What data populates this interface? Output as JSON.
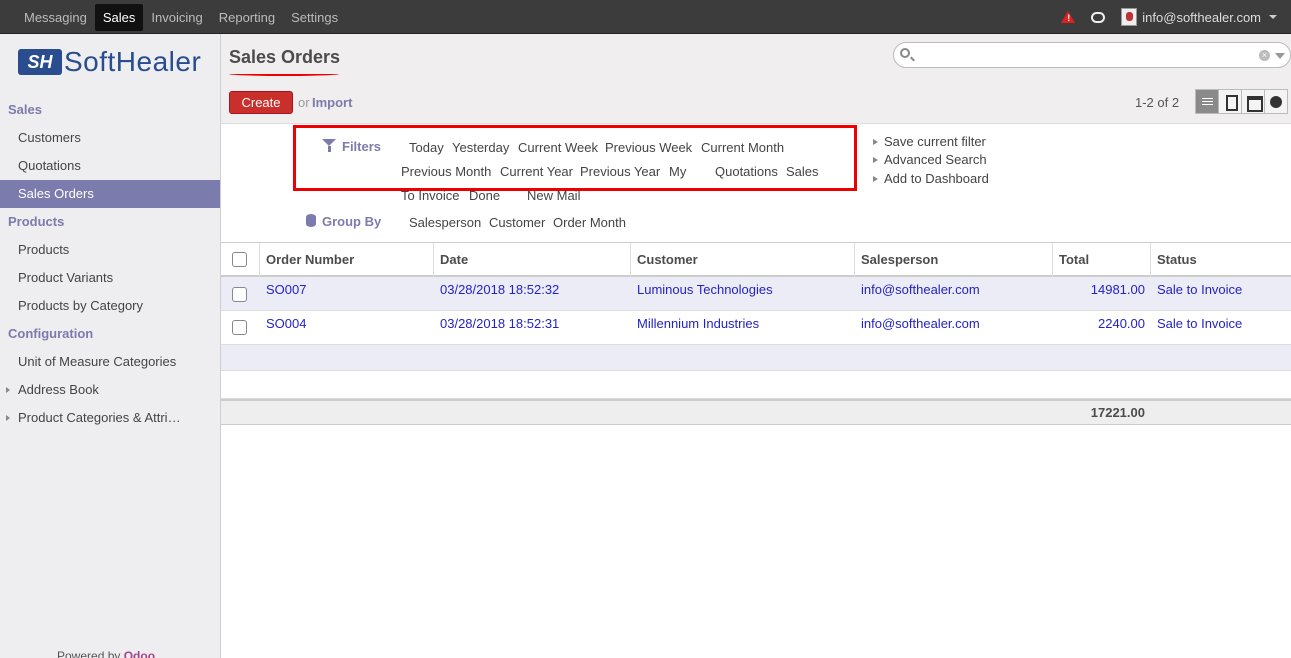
{
  "topnav": {
    "items": [
      "Messaging",
      "Sales",
      "Invoicing",
      "Reporting",
      "Settings"
    ],
    "active": "Sales",
    "user_email": "info@softhealer.com"
  },
  "sidebar": {
    "logo_mark": "SH",
    "logo_text": "SoftHealer",
    "sections": [
      {
        "title": "Sales",
        "items": [
          "Customers",
          "Quotations",
          "Sales Orders"
        ]
      },
      {
        "title": "Products",
        "items": [
          "Products",
          "Product Variants",
          "Products by Category"
        ]
      },
      {
        "title": "Configuration",
        "items": [
          "Unit of Measure Categories",
          "Address Book",
          "Product Categories & Attri…"
        ]
      }
    ],
    "powered_by": "Powered by",
    "powered_brand": "Odoo"
  },
  "header": {
    "title": "Sales Orders",
    "create_label": "Create",
    "or_label": "or",
    "import_label": "Import",
    "pager": "1-2 of 2",
    "search_placeholder": ""
  },
  "filters": {
    "label": "Filters",
    "options": [
      "Today",
      "Yesterday",
      "Current Week",
      "Previous Week",
      "Current Month",
      "Previous Month",
      "Current Year",
      "Previous Year",
      "My",
      "Quotations",
      "Sales",
      "To Invoice",
      "Done",
      "New Mail"
    ],
    "groupby_label": "Group By",
    "groupby_options": [
      "Salesperson",
      "Customer",
      "Order Month"
    ],
    "side_options": [
      "Save current filter",
      "Advanced Search",
      "Add to Dashboard"
    ]
  },
  "table": {
    "columns": [
      "Order Number",
      "Date",
      "Customer",
      "Salesperson",
      "Total",
      "Status"
    ],
    "rows": [
      {
        "order": "SO007",
        "date": "03/28/2018 18:52:32",
        "customer": "Luminous Technologies",
        "salesperson": "info@softhealer.com",
        "total": "14981.00",
        "status": "Sale to Invoice"
      },
      {
        "order": "SO004",
        "date": "03/28/2018 18:52:31",
        "customer": "Millennium Industries",
        "salesperson": "info@softhealer.com",
        "total": "2240.00",
        "status": "Sale to Invoice"
      }
    ],
    "sum_total": "17221.00"
  },
  "colors": {
    "accent": "#7c7bad",
    "create_button": "#c9302c",
    "link": "#2323c5",
    "highlight_box": "#ee0000"
  }
}
